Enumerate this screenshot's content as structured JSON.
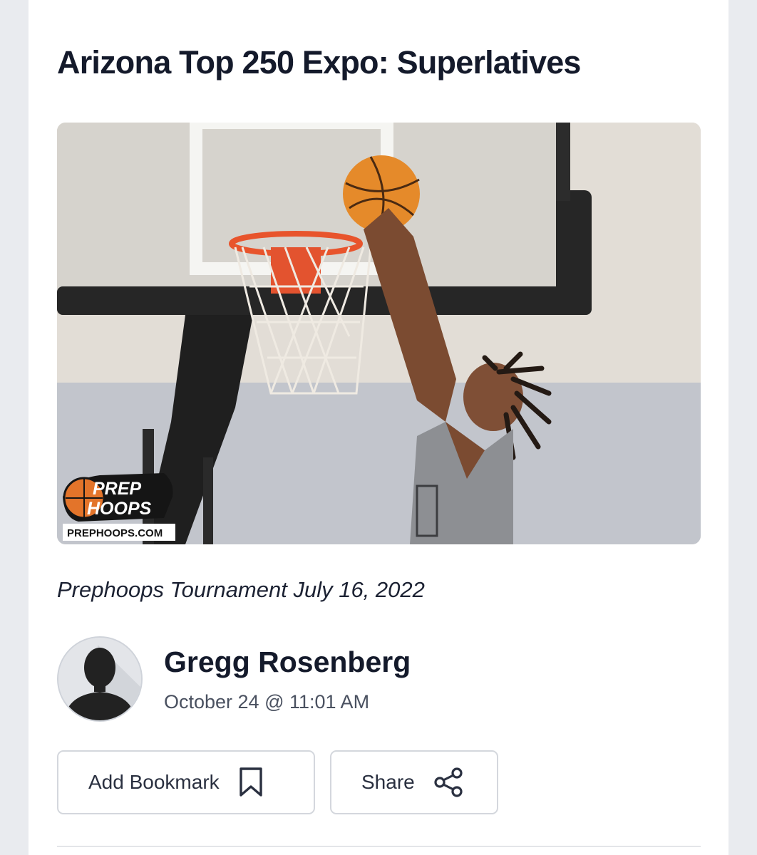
{
  "article": {
    "title": "Arizona Top 250 Expo: Superlatives",
    "image_caption": "Prephoops Tournament July 16, 2022",
    "watermark": {
      "line1": "PREP",
      "line2": "HOOPS",
      "site": "PREPHOOPS.COM"
    }
  },
  "author": {
    "name": "Gregg Rosenberg",
    "date": "October 24 @ 11:01 AM"
  },
  "actions": {
    "bookmark_label": "Add Bookmark",
    "bookmark_icon": "bookmark-icon",
    "share_label": "Share",
    "share_icon": "share-icon"
  },
  "colors": {
    "text": "#141a2b",
    "muted": "#4a5160",
    "border": "#d4d7dd",
    "page_bg": "#e9ebef"
  }
}
